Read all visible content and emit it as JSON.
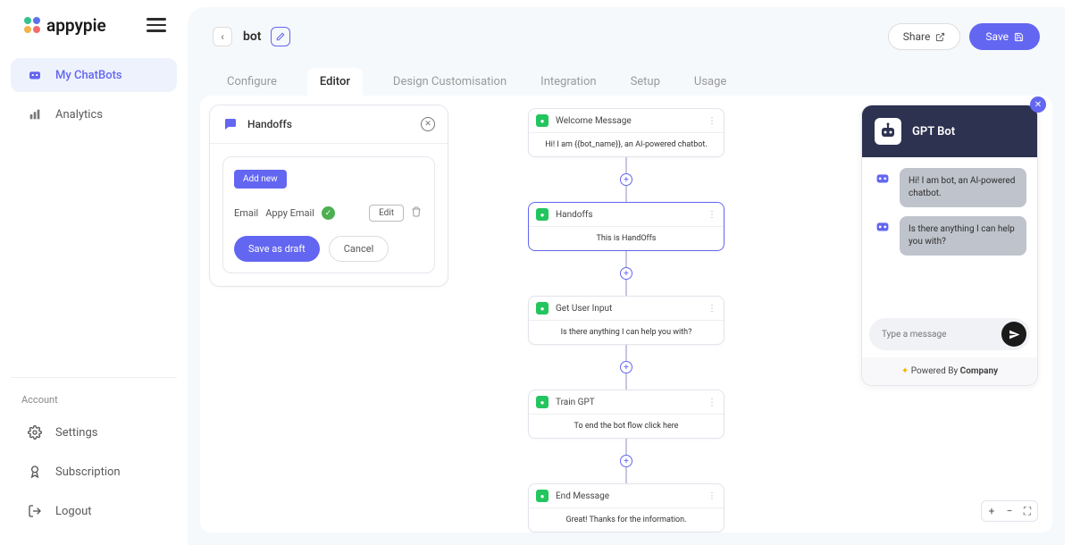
{
  "brand": "appypie",
  "sidebar": {
    "items": [
      {
        "label": "My ChatBots"
      },
      {
        "label": "Analytics"
      }
    ],
    "account_label": "Account",
    "account_items": [
      {
        "label": "Settings"
      },
      {
        "label": "Subscription"
      },
      {
        "label": "Logout"
      }
    ]
  },
  "topbar": {
    "bot_name": "bot",
    "share": "Share",
    "save": "Save"
  },
  "tabs": [
    "Configure",
    "Editor",
    "Design Customisation",
    "Integration",
    "Setup",
    "Usage"
  ],
  "active_tab": "Editor",
  "panel": {
    "title": "Handoffs",
    "add_new": "Add new",
    "email_label": "Email",
    "email_value": "Appy Email",
    "edit": "Edit",
    "save_draft": "Save as draft",
    "cancel": "Cancel"
  },
  "flow": [
    {
      "title": "Welcome Message",
      "body": "Hi! I am {{bot_name}}, an AI-powered chatbot."
    },
    {
      "title": "Handoffs",
      "body": "This is HandOffs",
      "selected": true
    },
    {
      "title": "Get User Input",
      "body": "Is there anything I can help you with?"
    },
    {
      "title": "Train GPT",
      "body": "To end the bot flow click here"
    },
    {
      "title": "End Message",
      "body": "Great! Thanks for the information."
    }
  ],
  "preview": {
    "bot_title": "GPT Bot",
    "messages": [
      "Hi! I am bot, an AI-powered chatbot.",
      "Is there anything I can help you with?"
    ],
    "placeholder": "Type a message",
    "powered_prefix": "Powered By ",
    "powered_company": "Company"
  }
}
